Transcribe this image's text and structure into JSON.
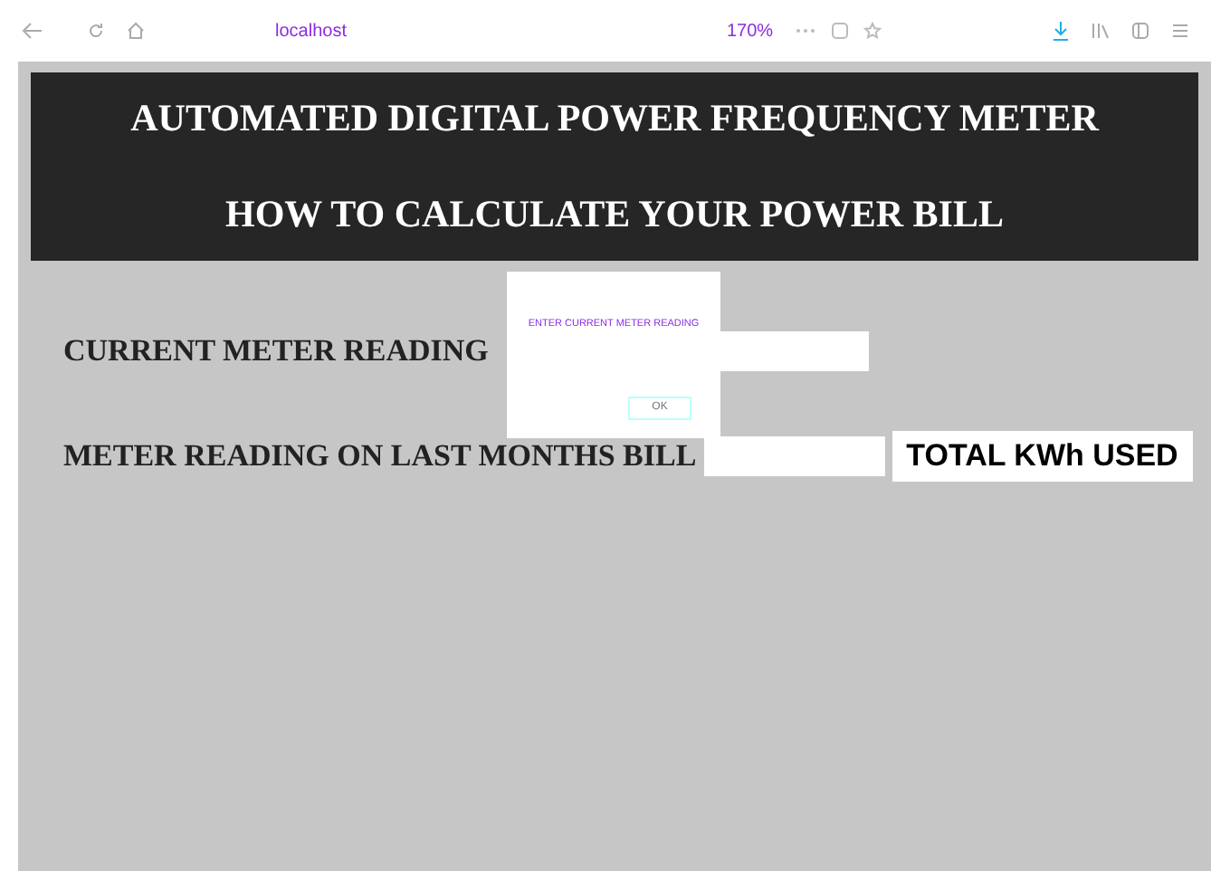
{
  "browser": {
    "url": "localhost",
    "zoom": "170%"
  },
  "header": {
    "title": "AUTOMATED DIGITAL POWER FREQUENCY METER",
    "subtitle": "HOW TO CALCULATE YOUR POWER BILL"
  },
  "fields": [
    {
      "label": "CURRENT METER READING"
    },
    {
      "label": "METER READING ON LAST MONTHS BILL"
    }
  ],
  "total_button": "TOTAL KWh USED",
  "dialog": {
    "message": "ENTER CURRENT METER READING",
    "ok": "OK"
  }
}
